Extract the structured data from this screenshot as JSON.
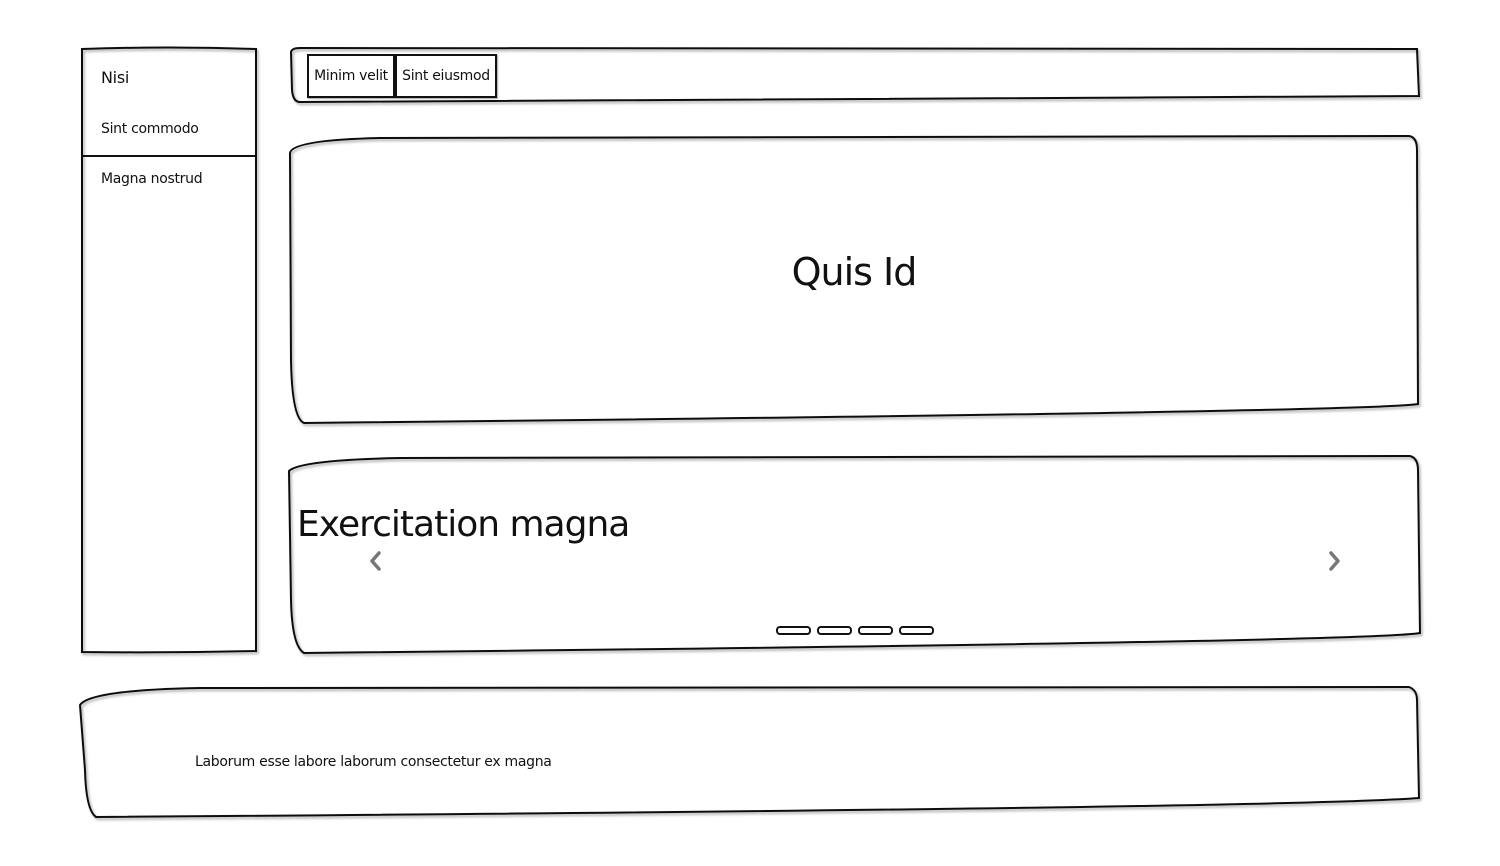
{
  "sidebar": {
    "items": [
      {
        "label": "Nisi"
      },
      {
        "label": "Sint commodo"
      },
      {
        "label": "Magna nostrud"
      }
    ]
  },
  "toolbar": {
    "tabs": [
      {
        "label": "Minim velit"
      },
      {
        "label": "Sint eiusmod"
      }
    ]
  },
  "hero": {
    "title": "Quis Id"
  },
  "carousel": {
    "title": "Exercitation magna",
    "prev_icon": "chevron-left-icon",
    "next_icon": "chevron-right-icon",
    "slide_count": 4
  },
  "footer": {
    "text": "Laborum esse labore laborum consectetur ex magna"
  }
}
